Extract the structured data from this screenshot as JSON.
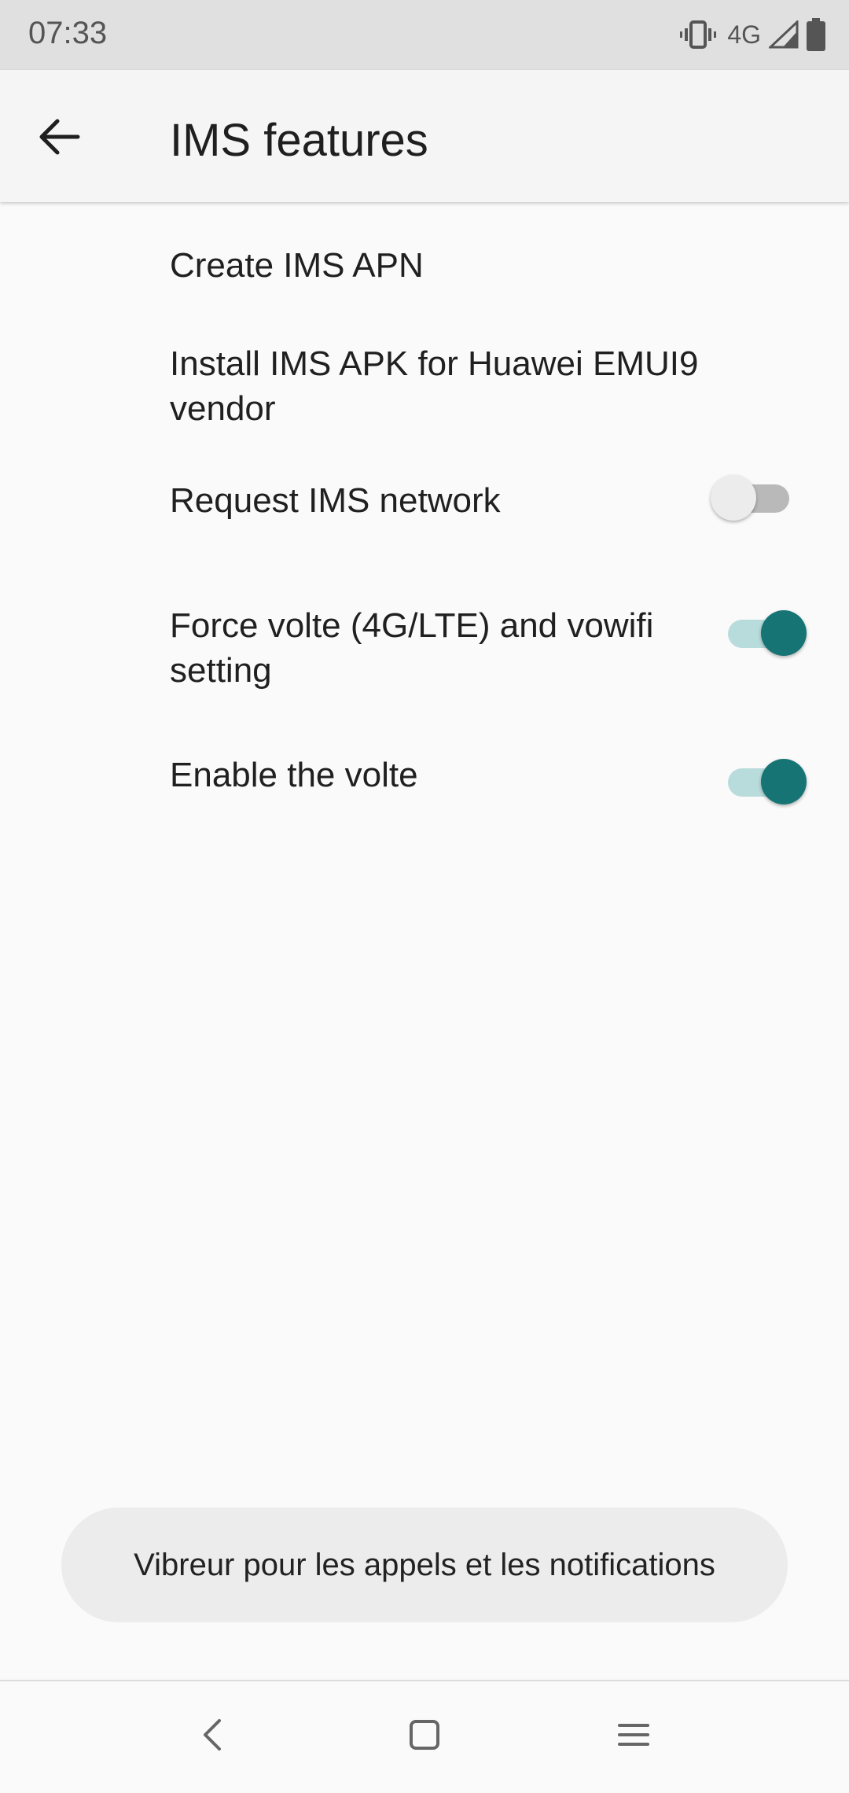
{
  "status_bar": {
    "time": "07:33",
    "network": "4G",
    "icons": [
      "vibrate-icon",
      "signal-icon",
      "battery-icon"
    ]
  },
  "app_bar": {
    "title": "IMS features",
    "back_icon": "arrow-back-icon"
  },
  "settings": [
    {
      "label": "Create IMS APN",
      "has_toggle": false
    },
    {
      "label": "Install IMS APK for Huawei EMUI9 vendor",
      "has_toggle": false
    },
    {
      "label": "Request IMS network",
      "has_toggle": true,
      "checked": false
    },
    {
      "label": "Force volte (4G/LTE) and vowifi setting",
      "has_toggle": true,
      "checked": true
    },
    {
      "label": "Enable the volte",
      "has_toggle": true,
      "checked": true
    }
  ],
  "toast": {
    "message": "Vibreur pour les appels et les notifications"
  },
  "navigation": {
    "buttons": [
      "nav-back-icon",
      "nav-home-icon",
      "nav-recents-icon"
    ]
  },
  "colors": {
    "accent": "#177475",
    "accent_track": "#b8dcdb",
    "status_bar_bg": "#e0e0e0",
    "app_bar_bg": "#f5f5f5",
    "page_bg": "#fafafa"
  }
}
